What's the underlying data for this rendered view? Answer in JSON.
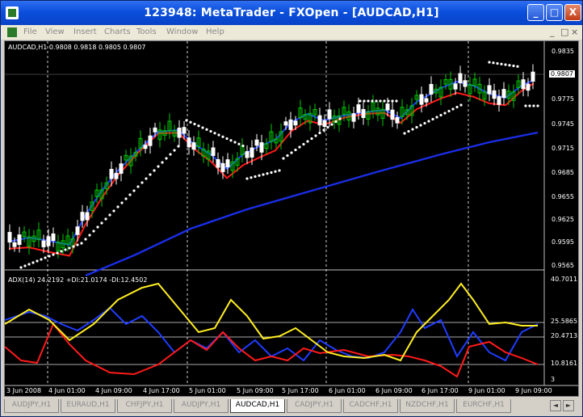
{
  "window": {
    "title": "123948: MetaTrader - FXOpen - [AUDCAD,H1]",
    "min_label": "_",
    "max_label": "□",
    "close_label": "X"
  },
  "menu": {
    "items": [
      "File",
      "View",
      "Insert",
      "Charts",
      "Tools",
      "Window",
      "Help"
    ],
    "right_controls": [
      "_",
      "□",
      "×"
    ]
  },
  "chart": {
    "symbol_info": "AUDCAD,H1  0.9808 0.9818 0.9805 0.9807",
    "indicator_info": "ADX(14) 24.2192 +DI:21.0174 -DI:12.4502",
    "price_labels": [
      "0.9835",
      "0.9807",
      "0.9775",
      "0.9745",
      "0.9715",
      "0.9685",
      "0.9655",
      "0.9625",
      "0.9595",
      "0.9565"
    ],
    "adx_labels": [
      "40.7011",
      "25.5865",
      "20.4713",
      "10.8161",
      "3"
    ],
    "time_labels": [
      "3 Jun 2008",
      "4 Jun 01:00",
      "4 Jun 09:00",
      "4 Jun 17:00",
      "5 Jun 01:00",
      "5 Jun 09:00",
      "5 Jun 17:00",
      "6 Jun 01:00",
      "6 Jun 09:00",
      "6 Jun 17:00",
      "9 Jun 01:00",
      "9 Jun 09:00"
    ],
    "colors": {
      "background": "#000000",
      "bull_candle": "#00c800",
      "bear_candle": "#ffffff",
      "fast_ma": "#1f3cff",
      "slow_ma": "#ff1a1a",
      "long_ma": "#1a2ee6",
      "sar": "#ffffff",
      "adx": "#ffee22",
      "plus_di": "#1f3cff",
      "minus_di": "#ff1a1a"
    }
  },
  "tabs": [
    "AUDJPY,H1",
    "EURAUD,H1",
    "CHFJPY,H1",
    "AUDJPY,H1",
    "AUDCAD,H1",
    "CADJPY,H1",
    "CADCHF,H1",
    "NZDCHF,H1",
    "EURCHF,H1"
  ],
  "active_tab_index": 4
}
